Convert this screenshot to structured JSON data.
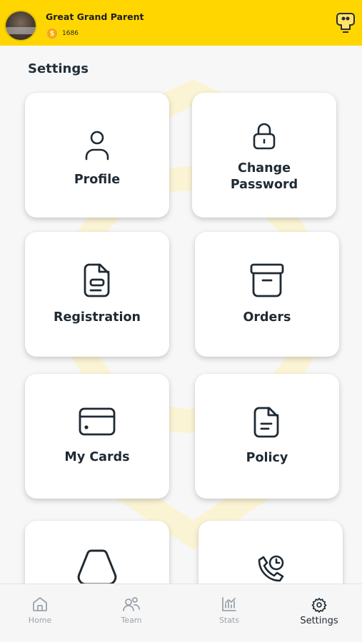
{
  "header": {
    "user_name": "Great Grand Parent",
    "coin_count": "1686",
    "background_color": "#ffd600"
  },
  "page": {
    "title": "Settings"
  },
  "cards": {
    "profile": {
      "label": "Profile",
      "icon": "user-icon"
    },
    "change_password": {
      "label_line1": "Change",
      "label_line2": "Password",
      "icon": "lock-icon"
    },
    "registration": {
      "label": "Registration",
      "icon": "document-icon"
    },
    "orders": {
      "label": "Orders",
      "icon": "archive-box-icon"
    },
    "my_cards": {
      "label": "My Cards",
      "icon": "credit-card-icon"
    },
    "policy": {
      "label": "Policy",
      "icon": "policy-document-icon"
    },
    "support": {
      "icon": "bell-shape-icon"
    },
    "contact": {
      "icon": "phone-clock-icon"
    }
  },
  "bottom_nav": {
    "items": [
      {
        "label": "Home",
        "icon": "home-icon"
      },
      {
        "label": "Team",
        "icon": "team-icon"
      },
      {
        "label": "Stats",
        "icon": "stats-icon"
      },
      {
        "label": "Settings",
        "icon": "gear-icon",
        "active": true
      }
    ]
  },
  "colors": {
    "accent": "#ffd600",
    "text_dark": "#1f2a33",
    "nav_inactive": "#9aa3ab"
  }
}
